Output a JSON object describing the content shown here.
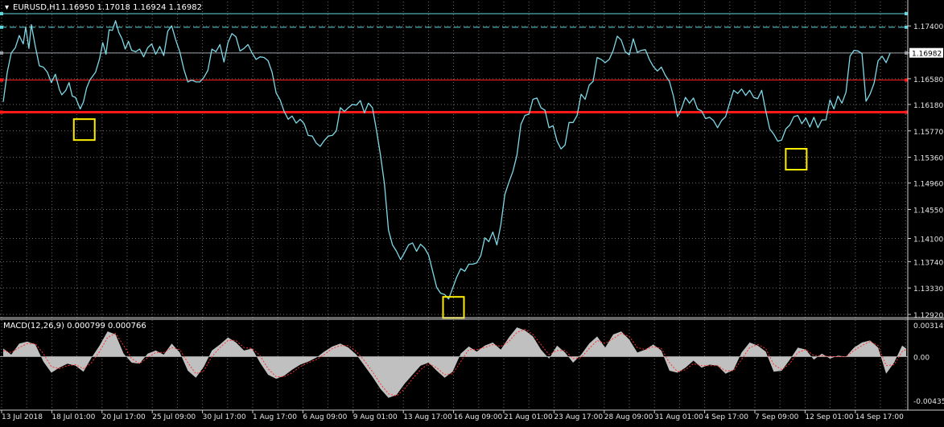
{
  "chart_data": [
    {
      "type": "line",
      "title": "EURUSD,H1",
      "ohlc_readout": "1.16950 1.17018 1.16924 1.16982",
      "y_ticks": [
        "1.17400",
        "1.16980",
        "1.16580",
        "1.16180",
        "1.15770",
        "1.15360",
        "1.14960",
        "1.14550",
        "1.14100",
        "1.13740",
        "1.13330",
        "1.12920"
      ],
      "ylim": [
        1.1292,
        1.1759
      ],
      "current_price": "1.16982",
      "x_ticks": [
        "13 Jul 2018",
        "18 Jul 01:00",
        "20 Jul 17:00",
        "25 Jul 09:00",
        "30 Jul 17:00",
        "1 Aug 17:00",
        "6 Aug 09:00",
        "9 Aug 01:00",
        "13 Aug 17:00",
        "16 Aug 09:00",
        "21 Aug 01:00",
        "23 Aug 17:00",
        "28 Aug 09:00",
        "31 Aug 01:00",
        "4 Sep 17:00",
        "7 Sep 09:00",
        "12 Sep 01:00",
        "14 Sep 17:00"
      ],
      "series": [
        {
          "color": "#7fd8e6",
          "x_index": [
            0,
            5,
            10,
            15,
            20,
            25,
            28,
            32,
            35,
            40,
            45,
            50,
            55,
            60,
            65,
            70,
            73,
            78,
            82,
            86,
            90,
            96,
            100,
            104,
            108,
            112,
            115,
            120,
            124,
            128,
            132,
            136,
            140,
            144,
            148,
            152,
            156,
            160,
            165,
            170,
            175,
            180,
            185,
            190,
            195,
            200,
            205,
            210,
            215,
            220,
            225,
            230,
            235,
            240,
            245,
            250,
            255,
            260,
            265,
            270,
            275,
            280,
            285,
            290,
            295,
            300,
            305,
            310,
            315,
            320,
            325,
            330,
            335,
            340,
            345,
            350,
            355,
            360,
            365,
            370,
            375,
            380,
            385,
            390,
            395,
            400,
            405,
            410,
            415,
            420,
            425,
            430,
            435,
            440,
            445,
            450,
            455,
            460,
            465,
            470,
            475,
            480,
            485,
            490,
            495,
            500,
            505,
            510,
            515,
            520,
            525,
            530,
            535,
            540,
            545,
            550,
            555,
            560,
            565,
            570,
            575,
            580,
            585,
            590,
            595,
            600,
            605,
            610,
            615,
            620,
            625,
            630,
            635,
            640,
            645,
            650,
            655,
            660,
            665,
            670,
            675,
            680,
            685,
            690,
            695,
            700,
            705,
            710,
            715,
            720,
            725,
            730,
            735,
            740,
            745,
            750,
            755,
            760,
            765,
            770,
            775,
            780,
            785,
            790,
            795,
            800,
            805,
            810,
            815,
            820,
            825,
            830,
            835,
            840,
            845,
            850,
            855,
            860,
            865,
            870,
            875,
            880,
            885,
            890,
            895,
            900,
            905,
            910,
            915,
            920,
            925,
            930,
            935,
            940,
            945,
            950,
            955,
            960,
            965,
            970,
            975,
            980,
            985,
            990,
            995,
            1000,
            1005,
            1010,
            1015,
            1020,
            1025,
            1030,
            1035,
            1040,
            1045,
            1050,
            1055,
            1060,
            1065,
            1070,
            1075,
            1080,
            1085,
            1090,
            1095,
            1100,
            1105,
            1110,
            1115,
            1120,
            1125
          ],
          "values": [
            1.1622,
            1.1668,
            1.1698,
            1.1706,
            1.1725,
            1.1712,
            1.1738,
            1.1705,
            1.1742,
            1.1708,
            1.1678,
            1.1676,
            1.1668,
            1.1652,
            1.1665,
            1.1641,
            1.1633,
            1.164,
            1.1652,
            1.1631,
            1.1629,
            1.1611,
            1.1622,
            1.1644,
            1.1656,
            1.1663,
            1.1668,
            1.1689,
            1.1714,
            1.1696,
            1.1734,
            1.1733,
            1.1748,
            1.173,
            1.172,
            1.1704,
            1.1716,
            1.1702,
            1.17,
            1.1704,
            1.1692,
            1.1706,
            1.1712,
            1.1696,
            1.1708,
            1.1694,
            1.1732,
            1.174,
            1.1718,
            1.17,
            1.1673,
            1.1653,
            1.1656,
            1.1653,
            1.1653,
            1.166,
            1.1671,
            1.1704,
            1.17,
            1.1711,
            1.1684,
            1.1714,
            1.1728,
            1.1723,
            1.1701,
            1.1705,
            1.1711,
            1.1698,
            1.1688,
            1.1692,
            1.1691,
            1.1686,
            1.1668,
            1.1636,
            1.1625,
            1.1607,
            1.1595,
            1.16,
            1.1589,
            1.1595,
            1.1588,
            1.157,
            1.1569,
            1.1558,
            1.1553,
            1.1562,
            1.1569,
            1.157,
            1.1577,
            1.1613,
            1.1607,
            1.1613,
            1.1618,
            1.1617,
            1.1624,
            1.1605,
            1.162,
            1.1613,
            1.1578,
            1.154,
            1.1495,
            1.1423,
            1.14,
            1.139,
            1.1377,
            1.1388,
            1.14,
            1.1403,
            1.139,
            1.1401,
            1.1395,
            1.1384,
            1.1359,
            1.1334,
            1.1325,
            1.1323,
            1.1316,
            1.1333,
            1.135,
            1.1363,
            1.1359,
            1.137,
            1.137,
            1.1372,
            1.1383,
            1.1411,
            1.1405,
            1.142,
            1.14,
            1.1431,
            1.1478,
            1.1497,
            1.1514,
            1.1539,
            1.1587,
            1.1601,
            1.1603,
            1.1626,
            1.1628,
            1.1613,
            1.1609,
            1.1582,
            1.1585,
            1.1561,
            1.1549,
            1.1555,
            1.159,
            1.159,
            1.1601,
            1.1634,
            1.1626,
            1.1648,
            1.1654,
            1.1691,
            1.1688,
            1.1683,
            1.1688,
            1.1702,
            1.1724,
            1.1718,
            1.17,
            1.1695,
            1.172,
            1.1699,
            1.1702,
            1.1703,
            1.1688,
            1.1677,
            1.167,
            1.1676,
            1.1663,
            1.1654,
            1.1631,
            1.1599,
            1.1611,
            1.1629,
            1.162,
            1.1628,
            1.1611,
            1.1608,
            1.1596,
            1.1598,
            1.1593,
            1.1582,
            1.1593,
            1.1599,
            1.162,
            1.164,
            1.1635,
            1.1642,
            1.1632,
            1.164,
            1.1629,
            1.1627,
            1.164,
            1.1608,
            1.158,
            1.1572,
            1.1561,
            1.1563,
            1.158,
            1.1586,
            1.1599,
            1.1601,
            1.1588,
            1.1597,
            1.1583,
            1.1598,
            1.1582,
            1.1594,
            1.1594,
            1.1625,
            1.1611,
            1.1631,
            1.162,
            1.1637,
            1.1693,
            1.1702,
            1.1701,
            1.1697,
            1.1623,
            1.1634,
            1.1651,
            1.1686,
            1.1693,
            1.1683,
            1.1698
          ]
        }
      ],
      "horizontal_lines": [
        {
          "price": 1.1759,
          "color": "#5fd7e0",
          "style": "solid"
        },
        {
          "price": 1.1738,
          "color": "#5fd7e0",
          "style": "dashed"
        },
        {
          "price": 1.1698,
          "color": "#9aa0a6",
          "style": "solid"
        },
        {
          "price": 1.1656,
          "color": "#ff1a1a",
          "style": "solid"
        },
        {
          "price": 1.1606,
          "color": "#ff1a1a",
          "style": "solid-thick"
        }
      ],
      "highlight_boxes": [
        {
          "x_index": 101,
          "price": 1.1579
        },
        {
          "x_index": 561,
          "price": 1.1303
        },
        {
          "x_index": 988,
          "price": 1.1533
        }
      ],
      "grid": true
    },
    {
      "type": "area",
      "title": "MACD(12,26,9) 0.000799 0.000766",
      "y_ticks": [
        "0.003149",
        "0.00",
        "-0.004353"
      ],
      "ylim": [
        -0.004353,
        0.003149
      ],
      "series": [
        {
          "color": "#c0c0c0",
          "x_index": [
            0,
            10,
            20,
            30,
            40,
            50,
            60,
            70,
            80,
            90,
            100,
            110,
            120,
            130,
            140,
            150,
            160,
            170,
            180,
            190,
            200,
            210,
            220,
            230,
            240,
            250,
            260,
            270,
            280,
            290,
            300,
            310,
            320,
            330,
            340,
            350,
            360,
            370,
            380,
            390,
            400,
            410,
            420,
            430,
            440,
            450,
            460,
            470,
            480,
            490,
            500,
            510,
            520,
            530,
            540,
            550,
            560,
            570,
            580,
            590,
            600,
            610,
            620,
            630,
            640,
            650,
            660,
            670,
            680,
            690,
            700,
            710,
            720,
            730,
            740,
            750,
            760,
            770,
            780,
            790,
            800,
            810,
            820,
            830,
            840,
            850,
            860,
            870,
            880,
            890,
            900,
            910,
            920,
            930,
            940,
            950,
            960,
            970,
            980,
            990,
            1000,
            1010,
            1020,
            1030,
            1040,
            1050,
            1060,
            1070,
            1080,
            1090,
            1100,
            1110,
            1120,
            1125
          ],
          "values": [
            0.0008,
            0.0002,
            0.0013,
            0.0015,
            0.0012,
            -0.0005,
            -0.0016,
            -0.0011,
            -0.0007,
            -0.0009,
            -0.0015,
            -0.0001,
            0.0011,
            0.0025,
            0.0022,
            0.0003,
            -0.0006,
            -0.0007,
            0.0003,
            0.0006,
            0.0002,
            0.0013,
            0.0004,
            -0.0014,
            -0.0021,
            -0.001,
            0.0006,
            0.0012,
            0.0019,
            0.0014,
            0.0006,
            0.0008,
            -0.0006,
            -0.0018,
            -0.0022,
            -0.0019,
            -0.0013,
            -0.0008,
            -0.0005,
            -0.0001,
            0.0005,
            0.001,
            0.0013,
            0.0009,
            0.0002,
            -0.0009,
            -0.002,
            -0.0032,
            -0.0041,
            -0.0038,
            -0.0027,
            -0.0018,
            -0.0009,
            -0.0006,
            -0.0014,
            -0.0021,
            -0.0015,
            0.0003,
            0.001,
            0.0005,
            0.0011,
            0.0014,
            0.0007,
            0.0019,
            0.0029,
            0.0026,
            0.002,
            0.0007,
            -0.0002,
            0.0011,
            0.0004,
            -0.0006,
            0.0002,
            0.0013,
            0.002,
            0.0009,
            0.0022,
            0.0025,
            0.0017,
            0.0004,
            0.0007,
            0.0012,
            0.0006,
            -0.0014,
            -0.0016,
            -0.0011,
            -0.0004,
            -0.0011,
            -0.0008,
            -0.0009,
            -0.0017,
            -0.0013,
            0.0004,
            0.0014,
            0.0011,
            0.0005,
            -0.0015,
            -0.0014,
            -0.0003,
            0.0009,
            0.0007,
            -0.0003,
            0.0003,
            -0.0002,
            0.0001,
            0.0,
            0.0009,
            0.0014,
            0.0016,
            0.0009,
            -0.0017,
            -0.0006,
            0.0011,
            0.0008
          ]
        },
        {
          "color": "#ff3030",
          "style": "dotted",
          "x_index": [
            0,
            10,
            20,
            30,
            40,
            50,
            60,
            70,
            80,
            90,
            100,
            110,
            120,
            130,
            140,
            150,
            160,
            170,
            180,
            190,
            200,
            210,
            220,
            230,
            240,
            250,
            260,
            270,
            280,
            290,
            300,
            310,
            320,
            330,
            340,
            350,
            360,
            370,
            380,
            390,
            400,
            410,
            420,
            430,
            440,
            450,
            460,
            470,
            480,
            490,
            500,
            510,
            520,
            530,
            540,
            550,
            560,
            570,
            580,
            590,
            600,
            610,
            620,
            630,
            640,
            650,
            660,
            670,
            680,
            690,
            700,
            710,
            720,
            730,
            740,
            750,
            760,
            770,
            780,
            790,
            800,
            810,
            820,
            830,
            840,
            850,
            860,
            870,
            880,
            890,
            900,
            910,
            920,
            930,
            940,
            950,
            960,
            970,
            980,
            990,
            1000,
            1010,
            1020,
            1030,
            1040,
            1050,
            1060,
            1070,
            1080,
            1090,
            1100,
            1110,
            1120,
            1125
          ],
          "values": [
            0.0006,
            0.0004,
            0.0009,
            0.0013,
            0.0013,
            0.0003,
            -0.001,
            -0.0012,
            -0.0009,
            -0.0008,
            -0.0012,
            -0.0006,
            0.0005,
            0.0019,
            0.0023,
            0.0011,
            -0.0002,
            -0.0007,
            -0.0001,
            0.0004,
            0.0004,
            0.0009,
            0.0007,
            -0.0006,
            -0.0017,
            -0.0014,
            0.0,
            0.0009,
            0.0016,
            0.0016,
            0.0009,
            0.0008,
            0.0001,
            -0.0012,
            -0.002,
            -0.002,
            -0.0016,
            -0.001,
            -0.0006,
            -0.0003,
            0.0002,
            0.0008,
            0.0011,
            0.0011,
            0.0005,
            -0.0004,
            -0.0015,
            -0.0027,
            -0.0037,
            -0.0039,
            -0.0032,
            -0.0022,
            -0.0013,
            -0.0007,
            -0.0011,
            -0.0018,
            -0.0017,
            -0.0005,
            0.0007,
            0.0007,
            0.0009,
            0.0012,
            0.001,
            0.0015,
            0.0024,
            0.0027,
            0.0022,
            0.0012,
            0.0002,
            0.0006,
            0.0006,
            -0.0002,
            -0.0001,
            0.0008,
            0.0016,
            0.0013,
            0.0018,
            0.0023,
            0.002,
            0.0009,
            0.0007,
            0.001,
            0.0008,
            -0.0006,
            -0.0015,
            -0.0013,
            -0.0007,
            -0.0009,
            -0.0009,
            -0.0009,
            -0.0014,
            -0.0014,
            -0.0003,
            0.0009,
            0.0012,
            0.0008,
            -0.0008,
            -0.0013,
            -0.0007,
            0.0004,
            0.0007,
            0.0001,
            0.0001,
            0.0,
            0.0,
            0.0,
            0.0006,
            0.0011,
            0.0015,
            0.0011,
            -0.0009,
            -0.0008,
            0.0005,
            0.0007
          ]
        }
      ],
      "grid": true
    }
  ]
}
